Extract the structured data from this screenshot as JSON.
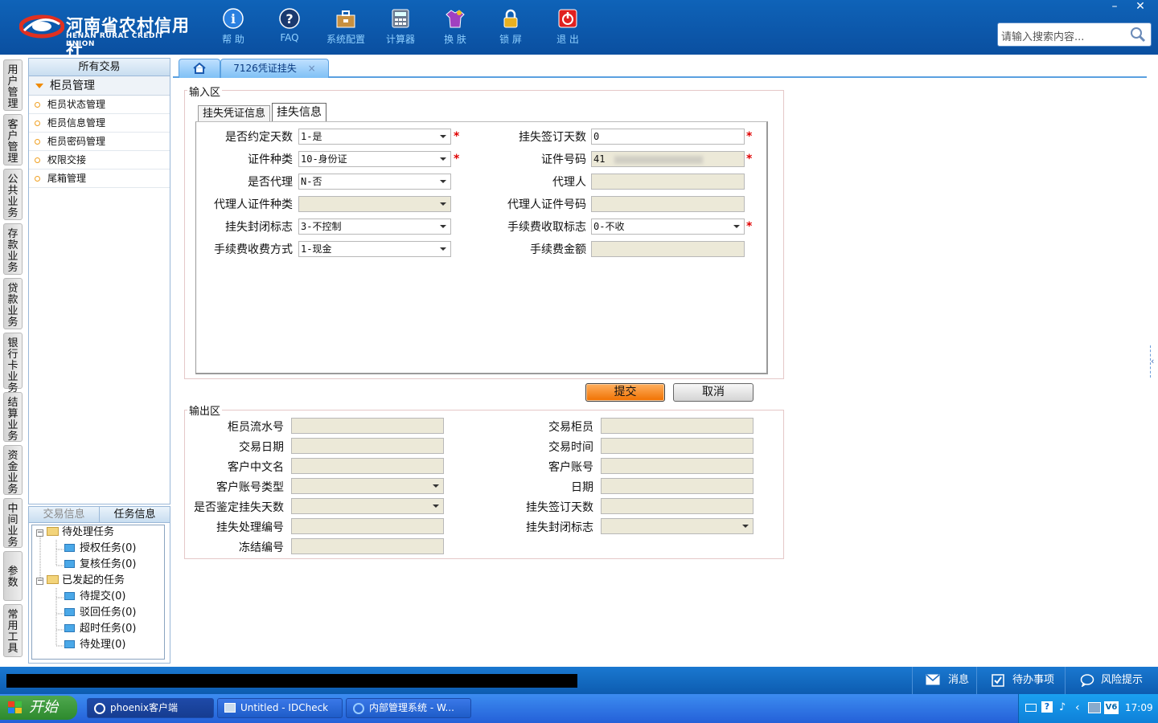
{
  "header": {
    "logo_cn": "河南省农村信用社",
    "logo_en": "HENAN RURAL CREDIT UNION",
    "toolbar": [
      {
        "label": "帮 助",
        "icon": "help-icon"
      },
      {
        "label": "FAQ",
        "icon": "faq-icon"
      },
      {
        "label": "系统配置",
        "icon": "toolbox-icon"
      },
      {
        "label": "计算器",
        "icon": "calculator-icon"
      },
      {
        "label": "换 肤",
        "icon": "shirt-icon"
      },
      {
        "label": "锁 屏",
        "icon": "lock-icon"
      },
      {
        "label": "退 出",
        "icon": "power-icon"
      }
    ],
    "search_placeholder": "请输入搜索内容..."
  },
  "vertical_tabs": [
    "用户管理",
    "客户管理",
    "公共业务",
    "存款业务",
    "贷款业务",
    "银行卡业务",
    "结算业务",
    "资金业务",
    "中间业务",
    "参数",
    "常用工具"
  ],
  "left_panel": {
    "header": "所有交易",
    "group": "柜员管理",
    "items": [
      "柜员状态管理",
      "柜员信息管理",
      "柜员密码管理",
      "权限交接",
      "尾箱管理"
    ]
  },
  "task_panel": {
    "tabs": [
      "交易信息",
      "任务信息"
    ],
    "tree": {
      "pending": "待处理任务",
      "pending_children": [
        "授权任务(0)",
        "复核任务(0)"
      ],
      "initiated": "已发起的任务",
      "initiated_children": [
        "待提交(0)",
        "驳回任务(0)",
        "超时任务(0)",
        "待处理(0)"
      ]
    }
  },
  "tabs": {
    "home_icon": "home-icon",
    "active": "7126凭证挂失",
    "close": "×"
  },
  "input_area": {
    "legend": "输入区",
    "subtabs": [
      "挂失凭证信息",
      "挂失信息"
    ],
    "left_fields": [
      {
        "label": "是否约定天数",
        "value": "1-是"
      },
      {
        "label": "证件种类",
        "value": "10-身份证"
      },
      {
        "label": "是否代理",
        "value": "N-否"
      },
      {
        "label": "代理人证件种类",
        "value": ""
      },
      {
        "label": "挂失封闭标志",
        "value": "3-不控制"
      },
      {
        "label": "手续费收费方式",
        "value": "1-现金"
      }
    ],
    "right_fields": [
      {
        "label": "挂失签订天数",
        "value": "0"
      },
      {
        "label": "证件号码",
        "value": "41"
      },
      {
        "label": "代理人",
        "value": ""
      },
      {
        "label": "代理人证件号码",
        "value": ""
      },
      {
        "label": "手续费收取标志",
        "value": "0-不收"
      },
      {
        "label": "手续费金额",
        "value": ""
      }
    ],
    "required_mark": "*"
  },
  "buttons": {
    "submit": "提交",
    "cancel": "取消"
  },
  "output_area": {
    "legend": "输出区",
    "left_labels": [
      "柜员流水号",
      "交易日期",
      "客户中文名",
      "客户账号类型",
      "是否鉴定挂失天数",
      "挂失处理编号",
      "冻结编号"
    ],
    "right_labels": [
      "交易柜员",
      "交易时间",
      "客户账号",
      "日期",
      "挂失签订天数",
      "挂失封闭标志"
    ]
  },
  "status_bar": {
    "items": [
      {
        "label": "消息",
        "icon": "envelope-icon"
      },
      {
        "label": "待办事项",
        "icon": "checkbox-icon"
      },
      {
        "label": "风险提示",
        "icon": "chat-icon"
      }
    ]
  },
  "taskbar": {
    "start": "开始",
    "tasks": [
      "phoenix客户端",
      "Untitled - IDCheck",
      "内部管理系统 - W..."
    ],
    "clock": "17:09",
    "tray_label": "V6"
  }
}
